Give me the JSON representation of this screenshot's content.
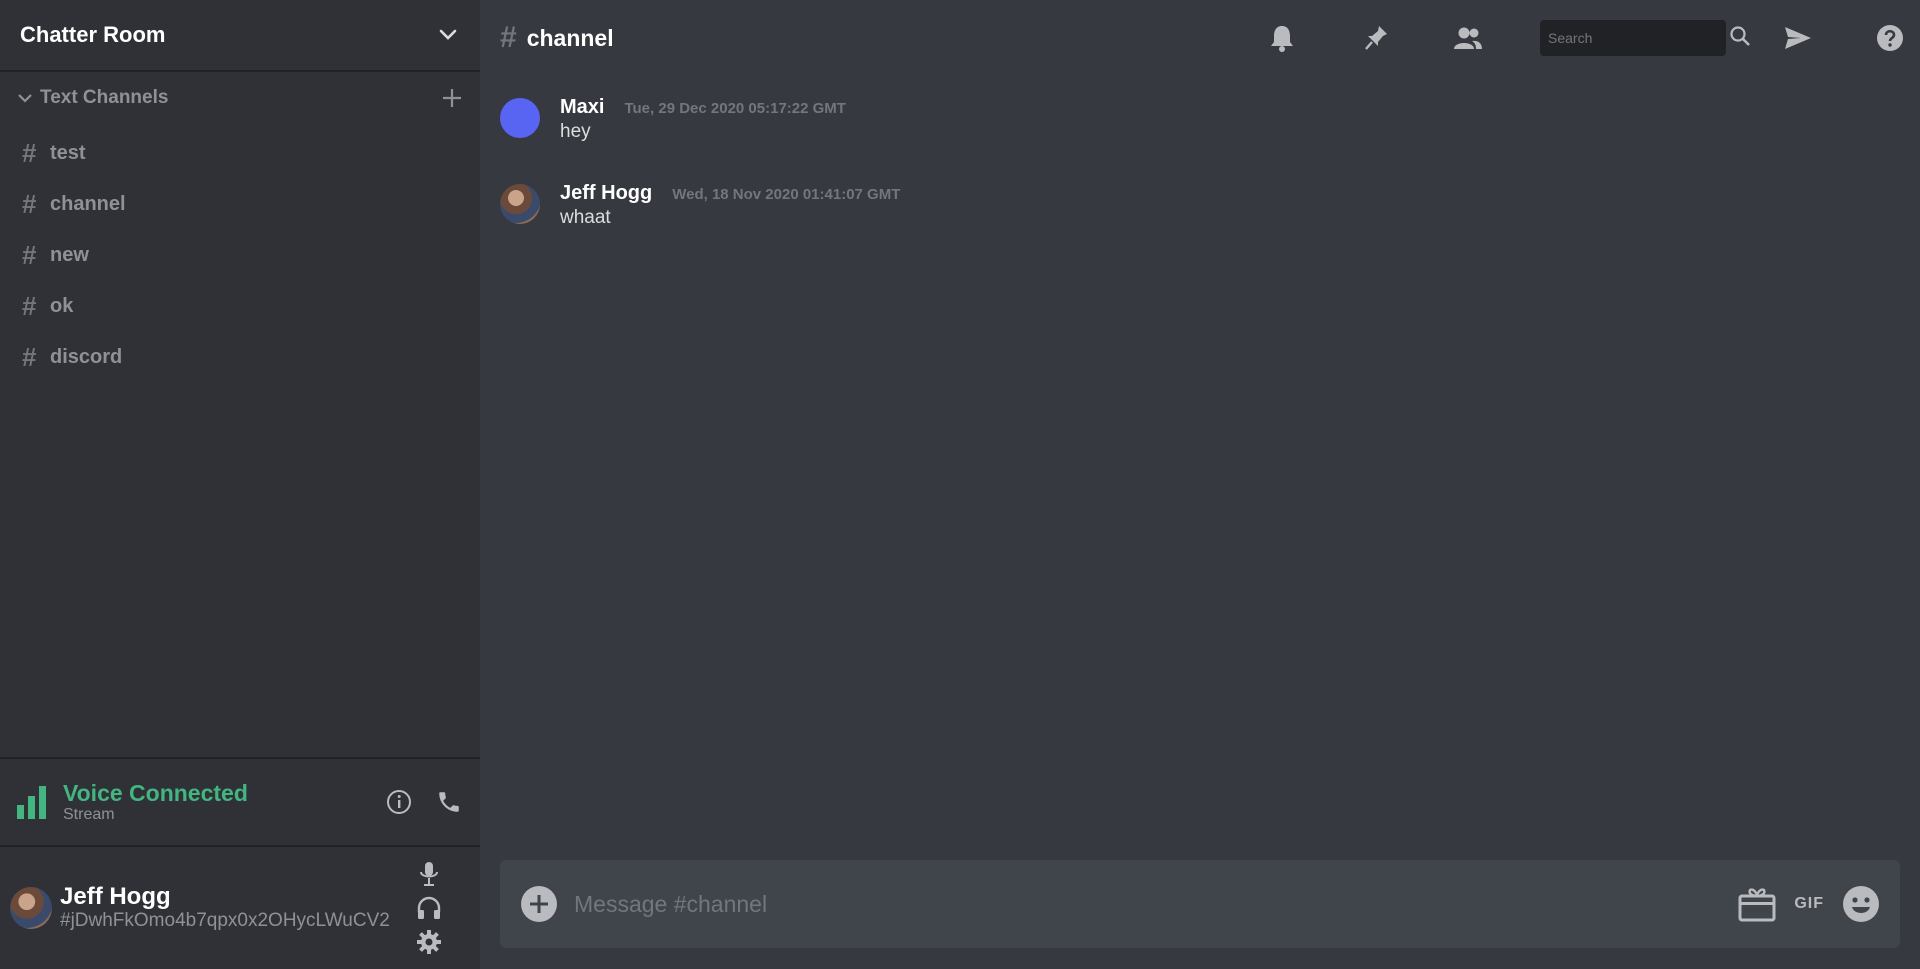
{
  "server": {
    "name": "Chatter Room"
  },
  "category": {
    "label": "Text Channels"
  },
  "channels": [
    {
      "label": "test"
    },
    {
      "label": "channel"
    },
    {
      "label": "new"
    },
    {
      "label": "ok"
    },
    {
      "label": "discord"
    }
  ],
  "channel_hash": "#",
  "voice": {
    "status": "Voice Connected",
    "sub": "Stream"
  },
  "user": {
    "name": "Jeff Hogg",
    "tag": "#jDwhFkOmo4b7qpx0x2OHycLWuCV2"
  },
  "topbar": {
    "hash": "#",
    "title": "channel"
  },
  "search": {
    "placeholder": "Search"
  },
  "messages": [
    {
      "author": "Maxi",
      "time": "Tue, 29 Dec 2020 05:17:22 GMT",
      "text": "hey"
    },
    {
      "author": "Jeff Hogg",
      "time": "Wed, 18 Nov 2020 01:41:07 GMT",
      "text": "whaat"
    }
  ],
  "composer": {
    "placeholder": "Message #channel",
    "gif_label": "GIF"
  },
  "colors": {
    "accent_green": "#43b581",
    "avatar_blue": "#5865f2",
    "sidebar": "#2f3136",
    "main": "#36393f"
  },
  "icons": [
    "chevron-down-icon",
    "plus-icon",
    "signal-bars-icon",
    "info-icon",
    "phone-icon",
    "microphone-icon",
    "headphones-icon",
    "gear-icon",
    "bell-icon",
    "pin-icon",
    "members-icon",
    "search-icon",
    "send-icon",
    "help-icon",
    "gift-icon",
    "emoji-icon"
  ]
}
